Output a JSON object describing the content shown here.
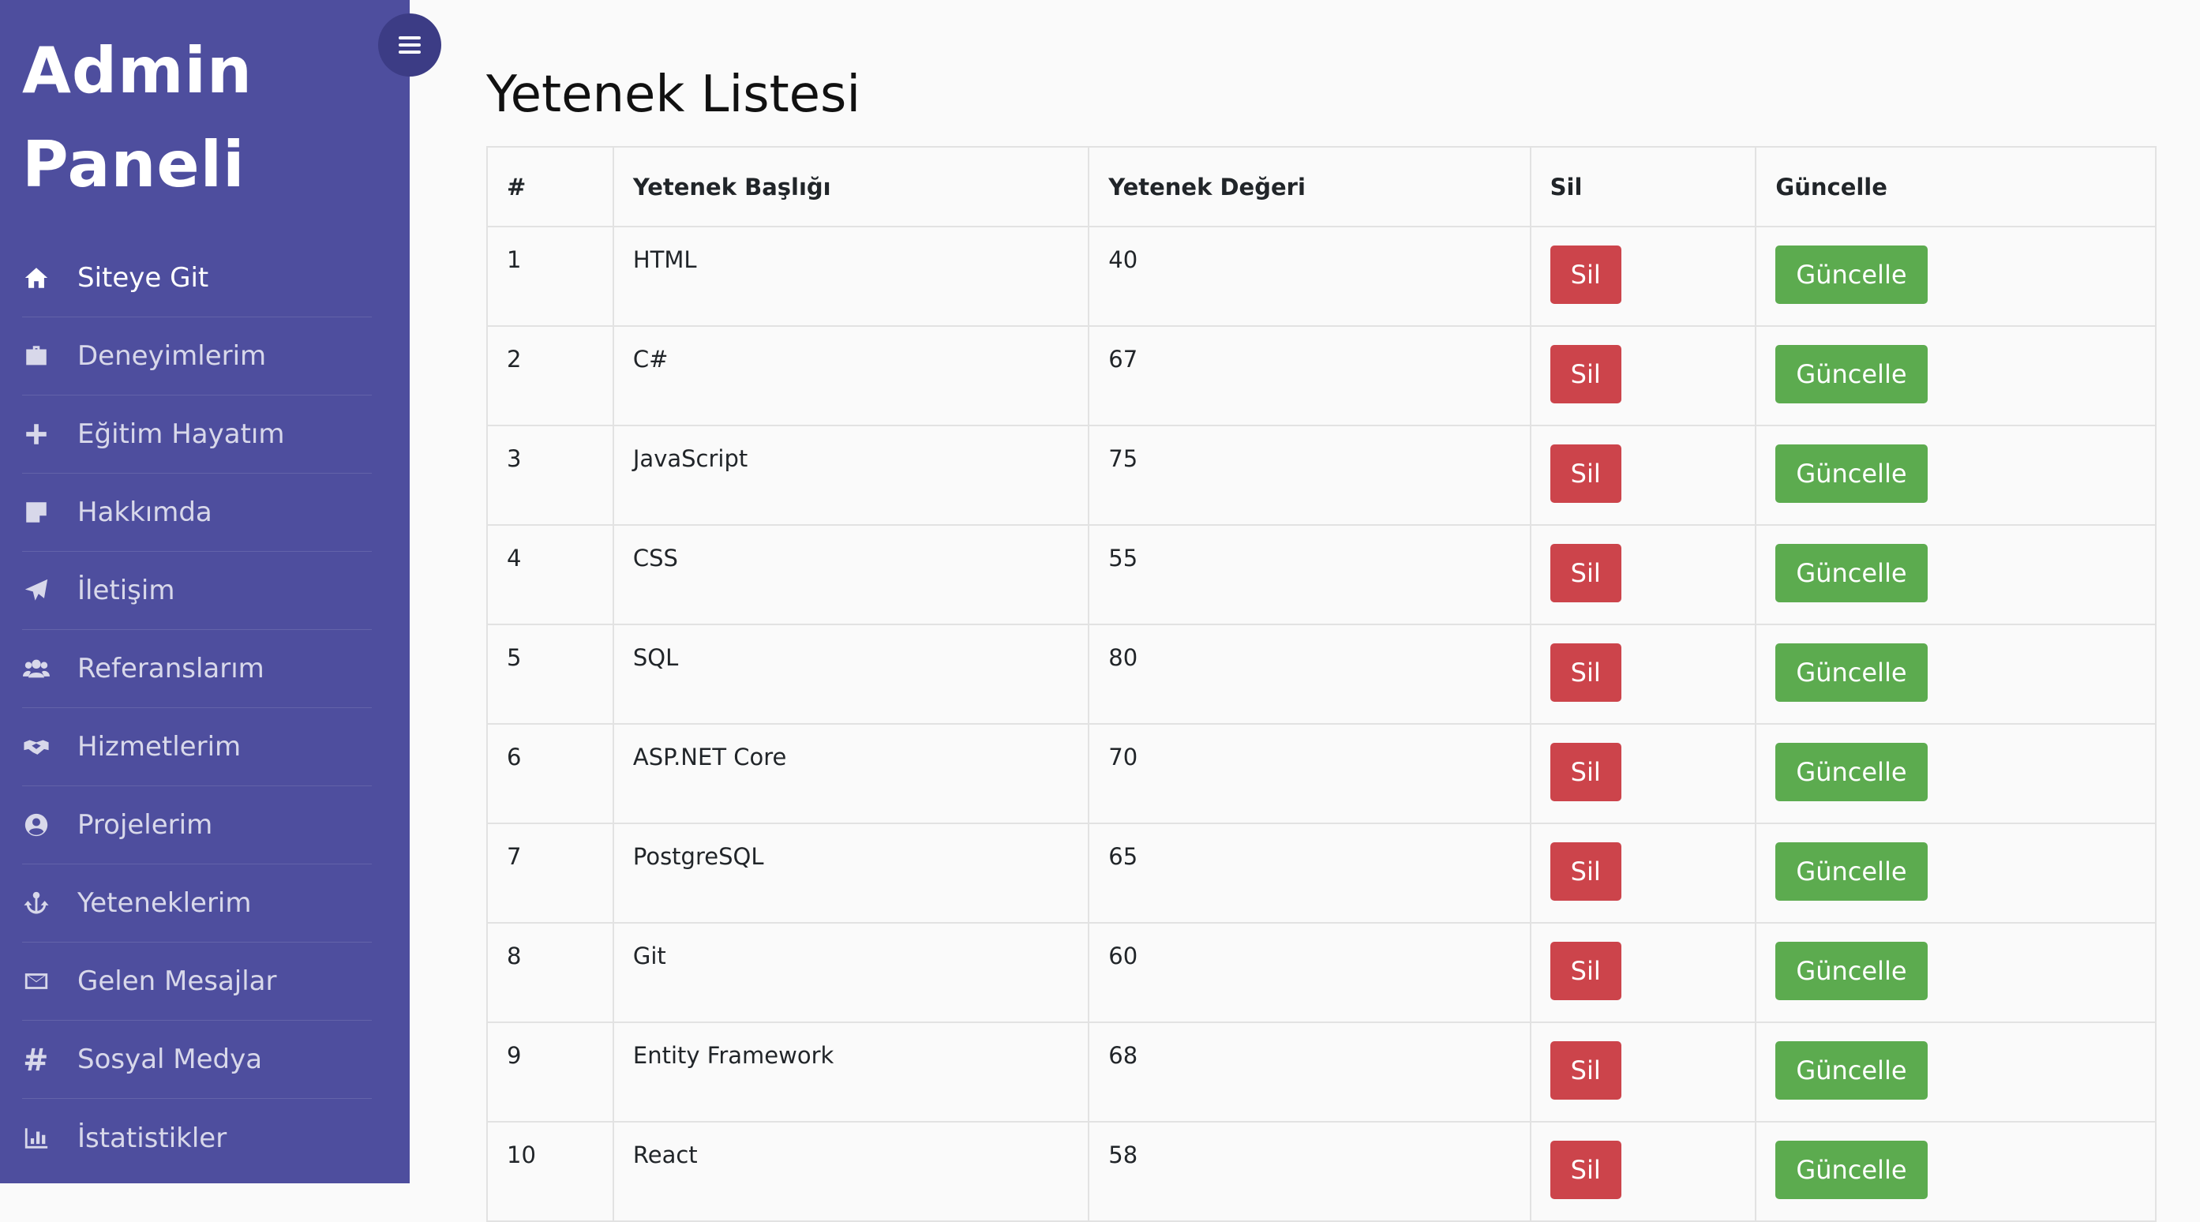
{
  "sidebar": {
    "brand_line1": "Admin",
    "brand_line2": "Paneli",
    "bg_color": "#4e4e9e",
    "items": [
      {
        "label": "Siteye Git",
        "icon": "home-icon",
        "active": true
      },
      {
        "label": "Deneyimlerim",
        "icon": "briefcase-icon"
      },
      {
        "label": "Eğitim Hayatım",
        "icon": "plus-icon"
      },
      {
        "label": "Hakkımda",
        "icon": "sticky-note-icon"
      },
      {
        "label": "İletişim",
        "icon": "paper-plane-icon"
      },
      {
        "label": "Referanslarım",
        "icon": "users-icon"
      },
      {
        "label": "Hizmetlerim",
        "icon": "handshake-icon"
      },
      {
        "label": "Projelerim",
        "icon": "user-circle-icon"
      },
      {
        "label": "Yeteneklerim",
        "icon": "anchor-icon"
      },
      {
        "label": "Gelen Mesajlar",
        "icon": "envelope-icon"
      },
      {
        "label": "Sosyal Medya",
        "icon": "hashtag-icon"
      },
      {
        "label": "İstatistikler",
        "icon": "bar-chart-icon"
      }
    ]
  },
  "toggle": {
    "icon": "hamburger-menu-icon"
  },
  "main": {
    "title": "Yetenek Listesi",
    "columns": [
      "#",
      "Yetenek Başlığı",
      "Yetenek Değeri",
      "Sil",
      "Güncelle"
    ],
    "delete_label": "Sil",
    "update_label": "Güncelle",
    "delete_color": "#cc444b",
    "update_color": "#5cab4f",
    "rows": [
      {
        "id": "1",
        "title": "HTML",
        "value": "40"
      },
      {
        "id": "2",
        "title": "C#",
        "value": "67"
      },
      {
        "id": "3",
        "title": "JavaScript",
        "value": "75"
      },
      {
        "id": "4",
        "title": "CSS",
        "value": "55"
      },
      {
        "id": "5",
        "title": "SQL",
        "value": "80"
      },
      {
        "id": "6",
        "title": "ASP.NET Core",
        "value": "70"
      },
      {
        "id": "7",
        "title": "PostgreSQL",
        "value": "65"
      },
      {
        "id": "8",
        "title": "Git",
        "value": "60"
      },
      {
        "id": "9",
        "title": "Entity Framework",
        "value": "68"
      },
      {
        "id": "10",
        "title": "React",
        "value": "58"
      }
    ]
  }
}
